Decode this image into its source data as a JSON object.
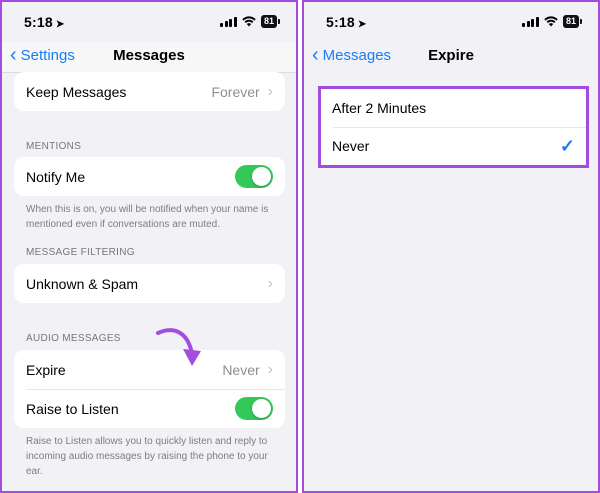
{
  "left": {
    "status": {
      "time": "5:18",
      "battery": "81"
    },
    "nav": {
      "back_label": "Settings",
      "title": "Messages"
    },
    "keep_messages": {
      "label": "Keep Messages",
      "value": "Forever"
    },
    "mentions": {
      "header": "MENTIONS",
      "notify_label": "Notify Me",
      "notify_on": true,
      "footnote": "When this is on, you will be notified when your name is mentioned even if conversations are muted."
    },
    "filtering": {
      "header": "MESSAGE FILTERING",
      "unknown_label": "Unknown & Spam"
    },
    "audio": {
      "header": "AUDIO MESSAGES",
      "expire_label": "Expire",
      "expire_value": "Never",
      "raise_label": "Raise to Listen",
      "raise_on": true,
      "footnote": "Raise to Listen allows you to quickly listen and reply to incoming audio messages by raising the phone to your ear."
    }
  },
  "right": {
    "status": {
      "time": "5:18",
      "battery": "81"
    },
    "nav": {
      "back_label": "Messages",
      "title": "Expire"
    },
    "options": [
      {
        "label": "After 2 Minutes",
        "selected": false
      },
      {
        "label": "Never",
        "selected": true
      }
    ]
  },
  "colors": {
    "accent": "#1b7cf6",
    "toggle_on": "#34c759",
    "highlight": "#a24de0",
    "background": "#f2f1f6"
  },
  "icons": [
    "location-arrow-icon",
    "cellular-signal-icon",
    "wifi-icon",
    "battery-icon",
    "chevron-left-icon",
    "chevron-right-icon",
    "checkmark-icon",
    "curved-arrow-icon"
  ]
}
